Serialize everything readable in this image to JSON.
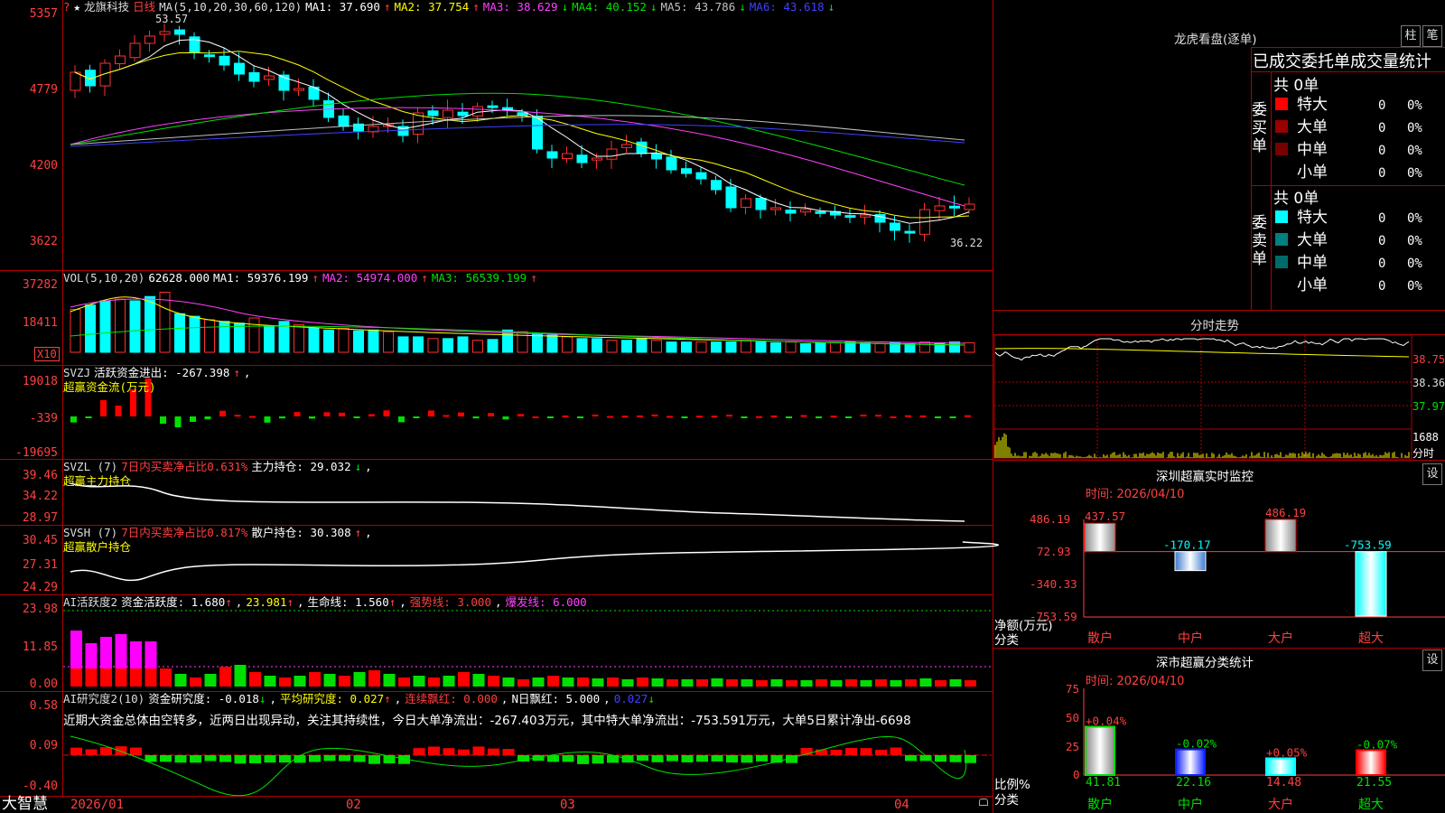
{
  "stock": {
    "name": "龙旗科技",
    "period": "日线",
    "ma_label": "MA(5,10,20,30,60,120)",
    "ma": [
      {
        "label": "MA1: 37.690",
        "arrow": "↑",
        "color": "#ffffff"
      },
      {
        "label": "MA2: 37.754",
        "arrow": "↑",
        "color": "#ffff00"
      },
      {
        "label": "MA3: 38.629",
        "arrow": "↓",
        "color": "#ff40ff"
      },
      {
        "label": "MA4: 40.152",
        "arrow": "↓",
        "color": "#00e000"
      },
      {
        "label": "MA5: 43.786",
        "arrow": "↓",
        "color": "#c0c0c0"
      },
      {
        "label": "MA6: 43.618",
        "arrow": "↓",
        "color": "#4040ff"
      }
    ],
    "high_label": "53.57",
    "low_label": "36.22",
    "y_labels": [
      "5357",
      "4779",
      "4200",
      "3622"
    ]
  },
  "vol": {
    "label": "VOL(5,10,20)",
    "value": "62628.000",
    "ma": [
      {
        "label": "MA1: 59376.199",
        "color": "#ffffff"
      },
      {
        "label": "MA2: 54974.000",
        "color": "#ff40ff"
      },
      {
        "label": "MA3: 56539.199",
        "color": "#00e000"
      }
    ],
    "y_labels": [
      "37282",
      "18411"
    ],
    "unit": "X10"
  },
  "svzj": {
    "label": "SVZJ",
    "text": "活跃资金进出: -267.398",
    "subtitle": "超赢资金流(万元)",
    "y_labels": [
      "19018",
      "-339",
      "-19695"
    ]
  },
  "svzl": {
    "label": "SVZL (7)",
    "text1": "7日内买卖净占比0.631%",
    "text2": "主力持仓: 29.032",
    "subtitle": "超赢主力持仓",
    "y_labels": [
      "39.46",
      "34.22",
      "28.97"
    ]
  },
  "svsh": {
    "label": "SVSH (7)",
    "text1": "7日内买卖净占比0.817%",
    "text2": "散户持仓: 30.308",
    "subtitle": "超赢散户持仓",
    "y_labels": [
      "30.45",
      "27.31",
      "24.29"
    ]
  },
  "ai1": {
    "label": "AI活跃度2",
    "text1": "资金活跃度: 1.680",
    "text2": "23.981",
    "text3": "生命线: 1.560",
    "text4": "强势线: 3.000",
    "text5": "爆发线: 6.000",
    "y_labels": [
      "23.98",
      "11.85",
      "0.00"
    ]
  },
  "ai2": {
    "label": "AI研究度2(10)",
    "text1": "资金研究度: -0.018",
    "text2": "平均研究度: 0.027",
    "text3": "连续飘红: 0.000",
    "text4": "N日飘红: 5.000",
    "text5": "0.027",
    "comment": "近期大资金总体由空转多，近两日出现异动，关注其持续性，今日大单净流出：-267.403万元，其中特大单净流出：-753.591万元，大单5日累计净出-6698",
    "y_labels": [
      "0.58",
      "0.09",
      "-0.40"
    ]
  },
  "x_axis": [
    "2026/01",
    "02",
    "03",
    "04"
  ],
  "brand": "大智慧",
  "dragon": {
    "title": "龙虎看盘(逐单)",
    "btn1": "柱",
    "btn2": "笔",
    "subtitle": "已成交委托单成交量统计",
    "buy": {
      "side": "委买单",
      "total": "共 0单",
      "rows": [
        {
          "label": "特大",
          "count": "0",
          "pct": "0%",
          "color": "#ff0000"
        },
        {
          "label": "大单",
          "count": "0",
          "pct": "0%",
          "color": "#990000"
        },
        {
          "label": "中单",
          "count": "0",
          "pct": "0%",
          "color": "#770000"
        },
        {
          "label": "小单",
          "count": "0",
          "pct": "0%",
          "color": "#000000"
        }
      ]
    },
    "sell": {
      "side": "委卖单",
      "total": "共 0单",
      "rows": [
        {
          "label": "特大",
          "count": "0",
          "pct": "0%",
          "color": "#00ffff"
        },
        {
          "label": "大单",
          "count": "0",
          "pct": "0%",
          "color": "#008080"
        },
        {
          "label": "中单",
          "count": "0",
          "pct": "0%",
          "color": "#006a6a"
        },
        {
          "label": "小单",
          "count": "0",
          "pct": "0%",
          "color": "#000000"
        }
      ]
    }
  },
  "intraday": {
    "title": "分时走势",
    "y_labels": [
      "38.75",
      "38.36",
      "37.97"
    ],
    "vol_label": "1688",
    "vol_unit": "分时"
  },
  "monitor": {
    "title": "深圳超赢实时监控",
    "btn": "设",
    "time": "时间: 2026/04/10",
    "y_labels": [
      "486.19",
      "72.93",
      "-340.33",
      "-753.59"
    ],
    "unit": "净额(万元)",
    "axis_label": "分类",
    "bars": [
      {
        "name": "散户",
        "value": 437.57,
        "label": "437.57"
      },
      {
        "name": "中户",
        "value": -170.17,
        "label": "-170.17"
      },
      {
        "name": "大户",
        "value": 486.19,
        "label": "486.19"
      },
      {
        "name": "超大",
        "value": -753.59,
        "label": "-753.59"
      }
    ]
  },
  "classify": {
    "title": "深市超赢分类统计",
    "btn": "设",
    "time": "时间: 2026/04/10",
    "y_labels": [
      "75",
      "50",
      "25",
      "0"
    ],
    "unit": "比例%",
    "axis_label": "分类",
    "bars": [
      {
        "name": "散户",
        "value": 41.81,
        "label": "41.81",
        "change": "+0.04%"
      },
      {
        "name": "中户",
        "value": 22.16,
        "label": "22.16",
        "change": "-0.02%"
      },
      {
        "name": "大户",
        "value": 14.48,
        "label": "14.48",
        "change": "+0.05%"
      },
      {
        "name": "超大",
        "value": 21.55,
        "label": "21.55",
        "change": "-0.07%"
      }
    ]
  },
  "chart_data": {
    "type": "bar",
    "title": "深圳超赢实时监控",
    "categories": [
      "散户",
      "中户",
      "大户",
      "超大"
    ],
    "values": [
      437.57,
      -170.17,
      486.19,
      -753.59
    ],
    "ylabel": "净额(万元)",
    "xlabel": "分类",
    "ylim": [
      -753.59,
      486.19
    ]
  }
}
